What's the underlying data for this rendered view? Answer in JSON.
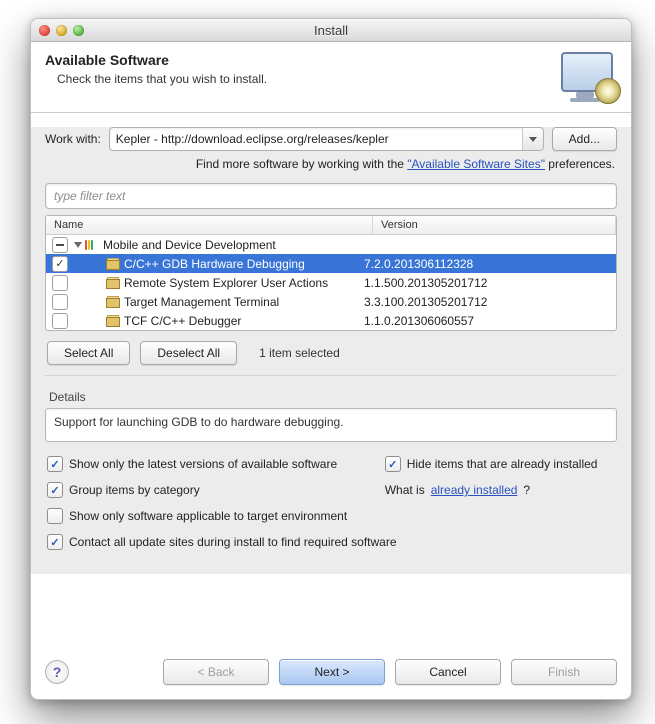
{
  "window": {
    "title": "Install"
  },
  "header": {
    "heading": "Available Software",
    "subheading": "Check the items that you wish to install."
  },
  "workWith": {
    "label": "Work with:",
    "value": "Kepler - http://download.eclipse.org/releases/kepler",
    "addButton": "Add...",
    "hintPrefix": "Find more software by working with the ",
    "hintLink": "\"Available Software Sites\"",
    "hintSuffix": " preferences."
  },
  "filter": {
    "placeholder": "type filter text"
  },
  "columns": {
    "name": "Name",
    "version": "Version"
  },
  "tree": {
    "category": {
      "label": "Mobile and Device Development",
      "expanded": true,
      "check": "minus"
    },
    "items": [
      {
        "checked": true,
        "selected": true,
        "label": "C/C++ GDB Hardware Debugging",
        "version": "7.2.0.201306112328"
      },
      {
        "checked": false,
        "selected": false,
        "label": "Remote System Explorer User Actions",
        "version": "1.1.500.201305201712"
      },
      {
        "checked": false,
        "selected": false,
        "label": "Target Management Terminal",
        "version": "3.3.100.201305201712"
      },
      {
        "checked": false,
        "selected": false,
        "label": "TCF C/C++ Debugger",
        "version": "1.1.0.201306060557"
      }
    ]
  },
  "actions": {
    "selectAll": "Select All",
    "deselectAll": "Deselect All",
    "selectedCount": "1 item selected"
  },
  "details": {
    "label": "Details",
    "text": "Support for launching GDB to do hardware debugging."
  },
  "options": {
    "latestOnly": {
      "label": "Show only the latest versions of available software",
      "checked": true
    },
    "hideInstalled": {
      "label": "Hide items that are already installed",
      "checked": true
    },
    "groupCategory": {
      "label": "Group items by category",
      "checked": true
    },
    "whatInstalledPrefix": "What is ",
    "whatInstalledLink": "already installed",
    "whatInstalledSuffix": "?",
    "applicableOnly": {
      "label": "Show only software applicable to target environment",
      "checked": false
    },
    "contactSites": {
      "label": "Contact all update sites during install to find required software",
      "checked": true
    }
  },
  "footer": {
    "back": "< Back",
    "next": "Next >",
    "cancel": "Cancel",
    "finish": "Finish"
  }
}
